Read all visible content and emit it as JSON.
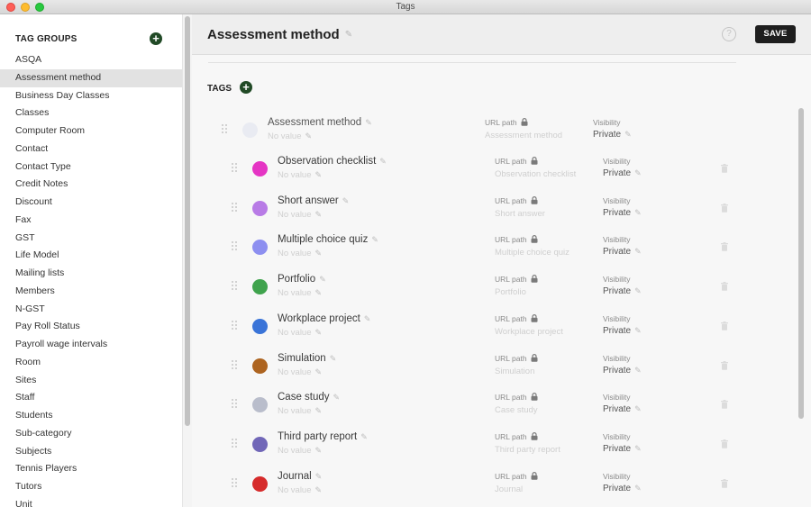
{
  "window": {
    "title": "Tags"
  },
  "sidebar": {
    "title": "TAG GROUPS",
    "items": [
      {
        "label": "ASQA",
        "active": false
      },
      {
        "label": "Assessment method",
        "active": true
      },
      {
        "label": "Business Day Classes",
        "active": false
      },
      {
        "label": "Classes",
        "active": false
      },
      {
        "label": "Computer Room",
        "active": false
      },
      {
        "label": "Contact",
        "active": false
      },
      {
        "label": "Contact Type",
        "active": false
      },
      {
        "label": "Credit Notes",
        "active": false
      },
      {
        "label": "Discount",
        "active": false
      },
      {
        "label": "Fax",
        "active": false
      },
      {
        "label": "GST",
        "active": false
      },
      {
        "label": "Life Model",
        "active": false
      },
      {
        "label": "Mailing lists",
        "active": false
      },
      {
        "label": "Members",
        "active": false
      },
      {
        "label": "N-GST",
        "active": false
      },
      {
        "label": "Pay Roll Status",
        "active": false
      },
      {
        "label": "Payroll wage intervals",
        "active": false
      },
      {
        "label": "Room",
        "active": false
      },
      {
        "label": "Sites",
        "active": false
      },
      {
        "label": "Staff",
        "active": false
      },
      {
        "label": "Students",
        "active": false
      },
      {
        "label": "Sub-category",
        "active": false
      },
      {
        "label": "Subjects",
        "active": false
      },
      {
        "label": "Tennis Players",
        "active": false
      },
      {
        "label": "Tutors",
        "active": false
      },
      {
        "label": "Unit",
        "active": false
      }
    ]
  },
  "header": {
    "title": "Assessment method",
    "help_glyph": "?",
    "save_label": "SAVE"
  },
  "tags_section": {
    "label": "TAGS"
  },
  "field_labels": {
    "url_path": "URL path",
    "visibility": "Visibility",
    "no_value": "No value"
  },
  "parent_tag": {
    "name": "Assessment method",
    "url": "Assessment method",
    "visibility": "Private",
    "color": "#e9ebf2"
  },
  "tags": [
    {
      "name": "Observation checklist",
      "url": "Observation checklist",
      "visibility": "Private",
      "color": "#e535c4"
    },
    {
      "name": "Short answer",
      "url": "Short answer",
      "visibility": "Private",
      "color": "#b87be6"
    },
    {
      "name": "Multiple choice quiz",
      "url": "Multiple choice quiz",
      "visibility": "Private",
      "color": "#8d8ff0"
    },
    {
      "name": "Portfolio",
      "url": "Portfolio",
      "visibility": "Private",
      "color": "#3fa34d"
    },
    {
      "name": "Workplace project",
      "url": "Workplace project",
      "visibility": "Private",
      "color": "#3a74d8"
    },
    {
      "name": "Simulation",
      "url": "Simulation",
      "visibility": "Private",
      "color": "#ad6420"
    },
    {
      "name": "Case study",
      "url": "Case study",
      "visibility": "Private",
      "color": "#b9bdcb"
    },
    {
      "name": "Third party report",
      "url": "Third party report",
      "visibility": "Private",
      "color": "#7167b8"
    },
    {
      "name": "Journal",
      "url": "Journal",
      "visibility": "Private",
      "color": "#d62b2b"
    }
  ],
  "icons": {
    "add": "plus-circle-icon",
    "edit": "pencil-icon",
    "lock": "lock-icon",
    "delete": "trash-icon",
    "drag": "drag-handle-icon",
    "help": "help-icon"
  }
}
